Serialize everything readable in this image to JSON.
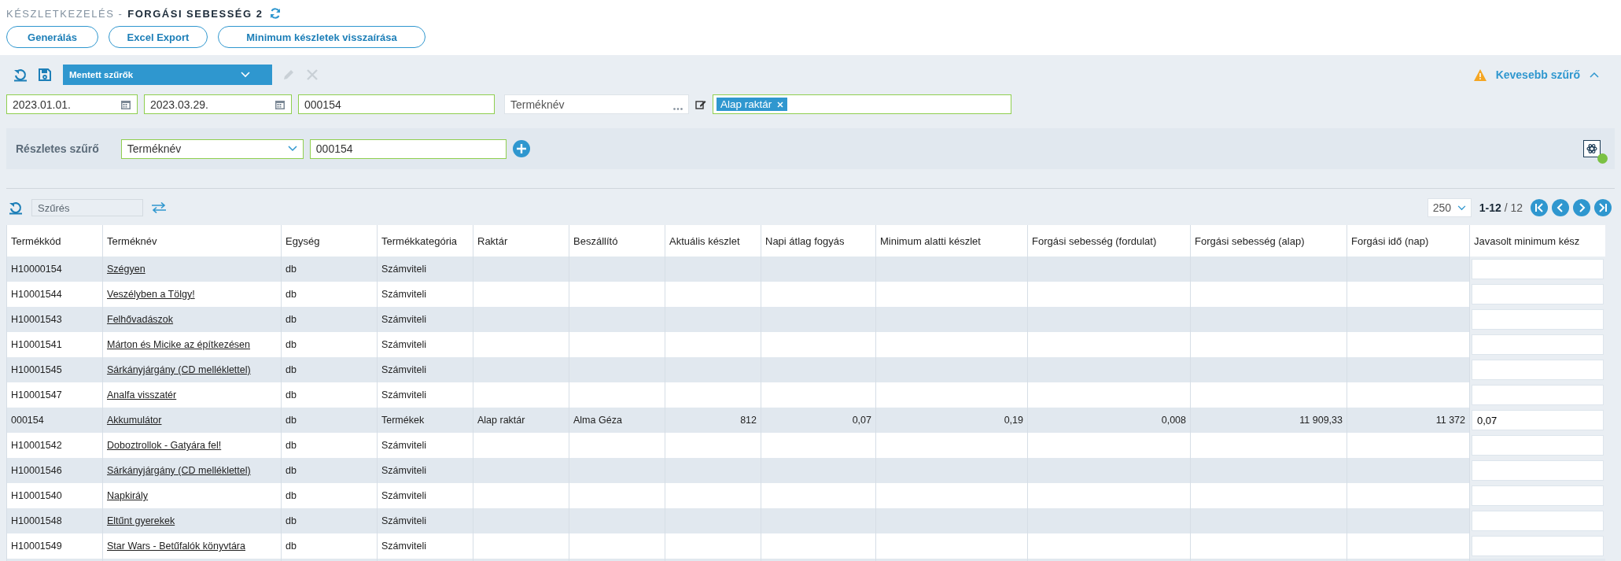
{
  "breadcrumb": {
    "section": "KÉSZLETKEZELÉS -",
    "title": "FORGÁSI SEBESSÉG 2"
  },
  "actions": [
    "Generálás",
    "Excel Export",
    "Minimum készletek visszaírása"
  ],
  "saved_filters": {
    "label": "Mentett szűrők",
    "edit_disabled": true,
    "delete_disabled": true
  },
  "fewer_filters": "Kevesebb szűrő",
  "filters": {
    "date_from": "2023.01.01.",
    "date_to": "2023.03.29.",
    "code": "000154",
    "product_placeholder": "Terméknév",
    "warehouse_tags": [
      "Alap raktár"
    ]
  },
  "detailed_filter": {
    "label": "Részletes szűrő",
    "field": "Terméknév",
    "value": "000154",
    "active": true
  },
  "list_toolbar": {
    "search_placeholder": "Szűrés",
    "page_size": "250",
    "range": "**1-12** / 12"
  },
  "table": {
    "columns": [
      "Termékkód",
      "Terméknév",
      "Egység",
      "Termékkategória",
      "Raktár",
      "Beszállító",
      "Aktuális készlet",
      "Napi átlag fogyás",
      "Minimum alatti készlet",
      "Forgási sebesség (fordulat)",
      "Forgási sebesség (alap)",
      "Forgási idő (nap)",
      "Javasolt minimum kész"
    ],
    "rows": [
      {
        "code": "H10000154",
        "name": "Szégyen",
        "unit": "db",
        "category": "Számviteli"
      },
      {
        "code": "H10001544",
        "name": "Veszélyben a Tölgy!",
        "unit": "db",
        "category": "Számviteli"
      },
      {
        "code": "H10001543",
        "name": "Felhővadászok",
        "unit": "db",
        "category": "Számviteli"
      },
      {
        "code": "H10001541",
        "name": "Márton és Micike az építkezésen",
        "unit": "db",
        "category": "Számviteli"
      },
      {
        "code": "H10001545",
        "name": "Sárkányjárgány (CD melléklettel)",
        "unit": "db",
        "category": "Számviteli"
      },
      {
        "code": "H10001547",
        "name": "Analfa visszatér",
        "unit": "db",
        "category": "Számviteli"
      },
      {
        "code": "000154",
        "name": "Akkumulátor",
        "unit": "db",
        "category": "Termékek",
        "warehouse": "Alap raktár",
        "supplier": "Alma Géza",
        "stock": "812",
        "daily": "0,07",
        "below_min": "0,19",
        "turnover_rate": "0,008",
        "turnover_base": "11 909,33",
        "turnover_days": "11 372",
        "suggested_min": "0,07"
      },
      {
        "code": "H10001542",
        "name": "Doboztrollok - Gatyára fel!",
        "unit": "db",
        "category": "Számviteli"
      },
      {
        "code": "H10001546",
        "name": "Sárkányjárgány (CD melléklettel)",
        "unit": "db",
        "category": "Számviteli"
      },
      {
        "code": "H10001540",
        "name": "Napkirály",
        "unit": "db",
        "category": "Számviteli"
      },
      {
        "code": "H10001548",
        "name": "Eltűnt gyerekek",
        "unit": "db",
        "category": "Számviteli"
      },
      {
        "code": "H10001549",
        "name": "Star Wars - Betűfalók könyvtára",
        "unit": "db",
        "category": "Számviteli"
      }
    ]
  }
}
